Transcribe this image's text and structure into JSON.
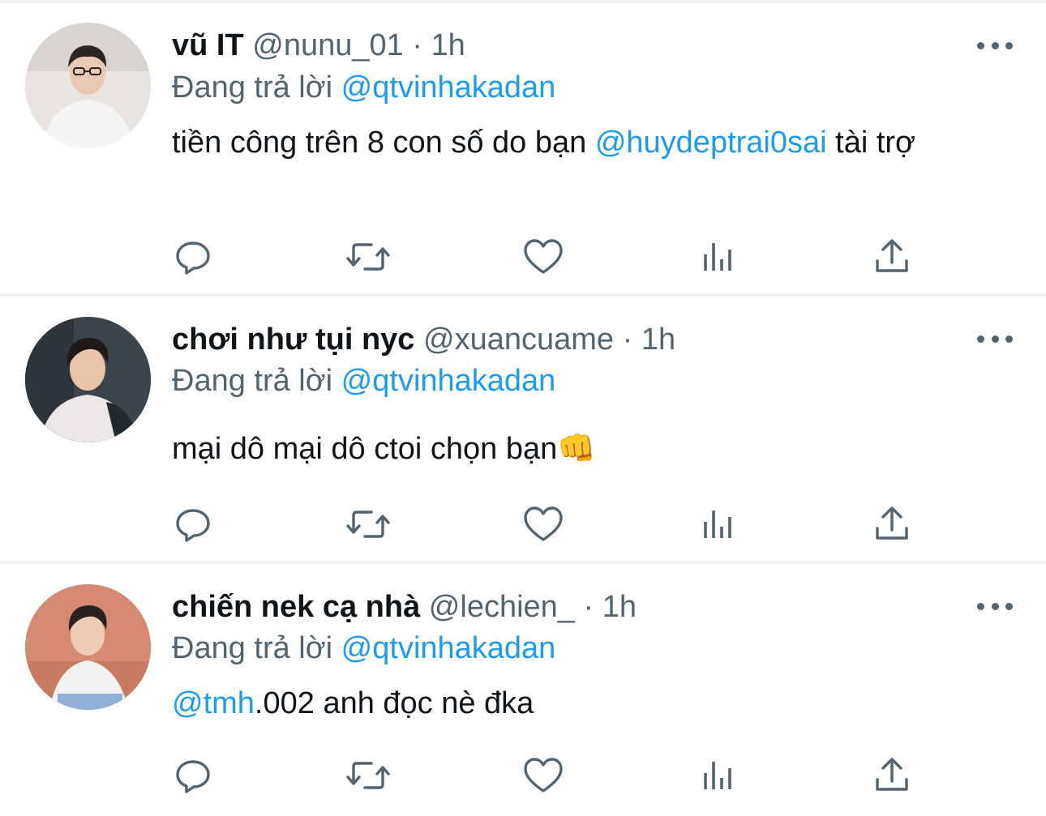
{
  "tweets": [
    {
      "display_name": "vũ IT",
      "handle": "@nunu_01",
      "separator": "·",
      "time": "1h",
      "reply_prefix": "Đang trả lời",
      "reply_to": "@qtvinhakadan",
      "body_part1": "tiền công trên 8 con số do bạn ",
      "body_mention": "@huydeptrai0sai",
      "body_part2": " tài trợ",
      "avatar_bg": "#e6e3e0"
    },
    {
      "display_name": "chơi như tụi nyc",
      "handle": "@xuancuame",
      "separator": "·",
      "time": "1h",
      "reply_prefix": "Đang trả lời",
      "reply_to": "@qtvinhakadan",
      "body_part1": "mại dô mại dô ctoi chọn bạn👊",
      "avatar_bg": "#3f4a52"
    },
    {
      "display_name": "chiến nek cạ nhà",
      "handle": "@lechien_",
      "separator": "·",
      "time": "1h",
      "reply_prefix": "Đang trả lời",
      "reply_to": "@qtvinhakadan",
      "body_mention": "@tmh",
      "body_part2": ".002 anh đọc nè đka",
      "avatar_bg": "#d9836d"
    }
  ],
  "icons": [
    "reply-icon",
    "retweet-icon",
    "like-icon",
    "analytics-icon",
    "share-icon",
    "more-icon"
  ],
  "colors": {
    "accent": "#1d9bf0",
    "secondary_text": "#536471",
    "primary_text": "#0f1419",
    "divider": "#eff3f4"
  }
}
